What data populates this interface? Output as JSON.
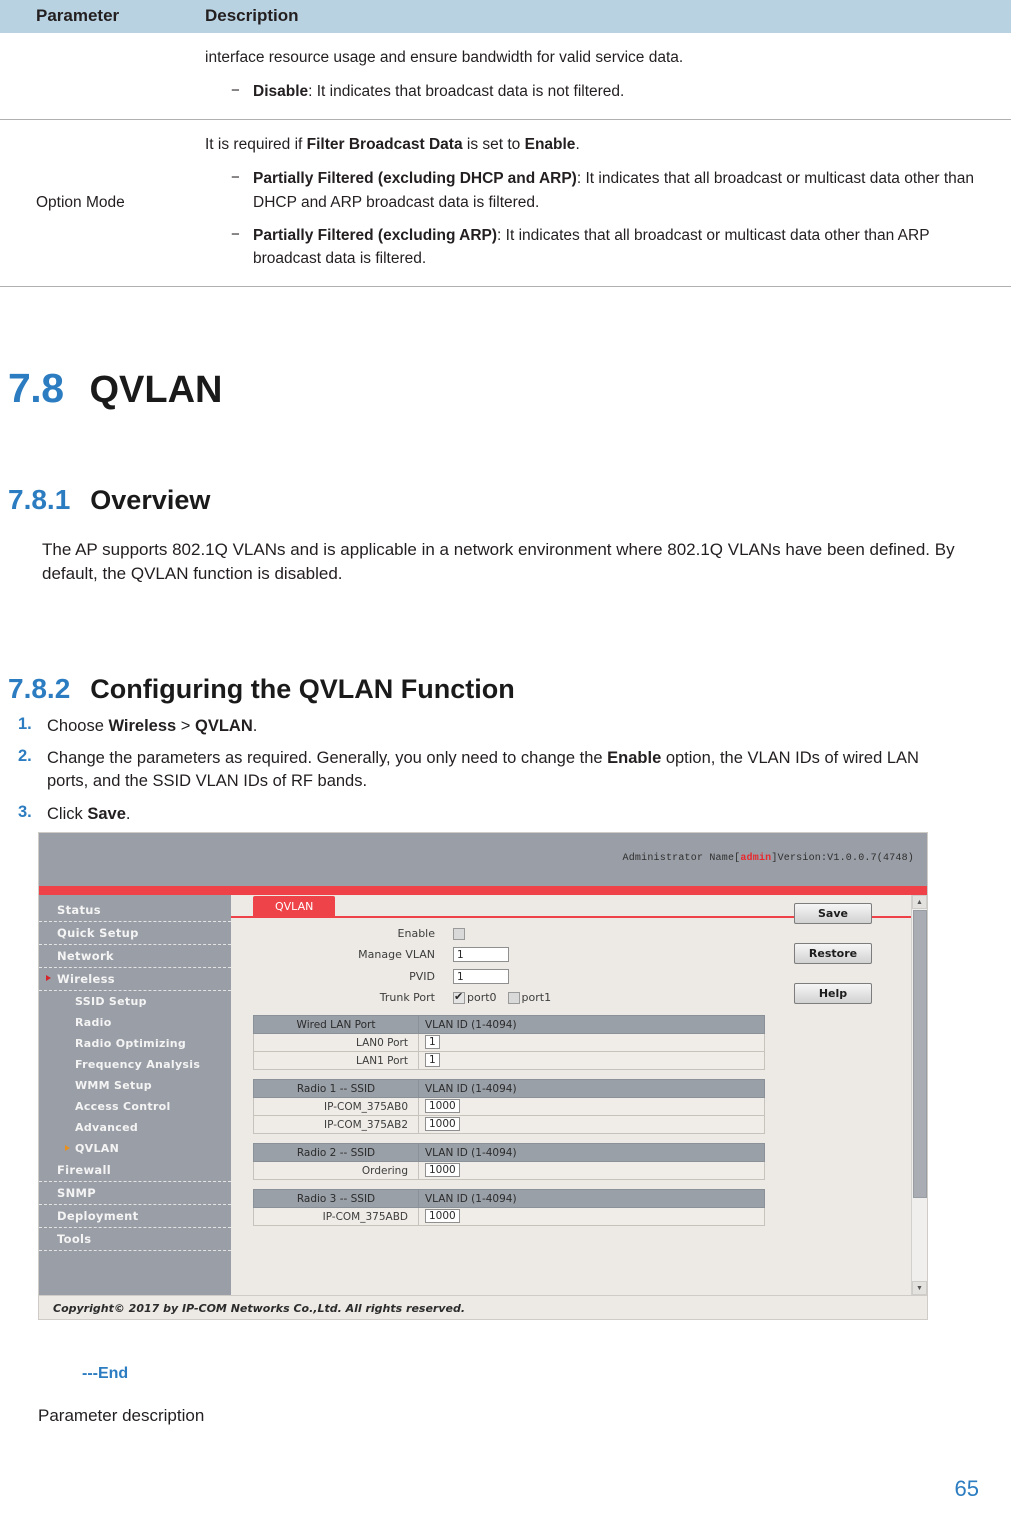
{
  "table": {
    "headers": [
      "Parameter",
      "Description"
    ],
    "rows": [
      {
        "parameter": "",
        "lead": "interface resource usage and ensure bandwidth for valid service data.",
        "bullets": [
          {
            "term": "Disable",
            "rest": ": It indicates that broadcast data is not filtered."
          }
        ]
      },
      {
        "parameter": "Option Mode",
        "lead_pre": "It is required if ",
        "lead_b1": "Filter Broadcast Data",
        "lead_mid": " is set to ",
        "lead_b2": "Enable",
        "lead_post": ".",
        "bullets": [
          {
            "term": "Partially Filtered (excluding DHCP and ARP)",
            "rest": ": It indicates that all broadcast or multicast data other than DHCP and ARP broadcast data is filtered."
          },
          {
            "term": "Partially Filtered (excluding ARP)",
            "rest": ": It indicates that all broadcast or multicast data other than ARP broadcast data is filtered."
          }
        ]
      }
    ],
    "dash_mark": "−"
  },
  "section_78": {
    "number": "7.8",
    "title": "QVLAN"
  },
  "section_781": {
    "number": "7.8.1",
    "title": "Overview",
    "paragraph": "The AP supports 802.1Q VLANs and is applicable in a network environment where 802.1Q VLANs have been defined. By default, the QVLAN function is disabled."
  },
  "section_782": {
    "number": "7.8.2",
    "title": "Configuring the QVLAN Function",
    "steps": [
      {
        "num": "1.",
        "pre": "Choose ",
        "b1": "Wireless",
        "mid": " > ",
        "b2": "QVLAN",
        "post": "."
      },
      {
        "num": "2.",
        "pre": "Change the parameters as required. Generally, you only need to change the ",
        "b1": "Enable",
        "mid": " option, the VLAN IDs of wired LAN ports, and the SSID VLAN IDs of RF bands.",
        "b2": "",
        "post": ""
      },
      {
        "num": "3.",
        "pre": "Click ",
        "b1": "Save",
        "mid": "",
        "b2": "",
        "post": "."
      }
    ]
  },
  "screenshot": {
    "admin_prefix": "Administrator Name[",
    "admin_user": "admin",
    "admin_suffix": "]Version:V1.0.0.7(4748)",
    "tab": "QVLAN",
    "nav": [
      {
        "label": "Status",
        "sub": false,
        "caret": false
      },
      {
        "label": "Quick Setup",
        "sub": false,
        "caret": false
      },
      {
        "label": "Network",
        "sub": false,
        "caret": false
      },
      {
        "label": "Wireless",
        "sub": false,
        "caret": true
      },
      {
        "label": "SSID Setup",
        "sub": true,
        "caret": false
      },
      {
        "label": "Radio",
        "sub": true,
        "caret": false
      },
      {
        "label": "Radio Optimizing",
        "sub": true,
        "caret": false
      },
      {
        "label": "Frequency Analysis",
        "sub": true,
        "caret": false
      },
      {
        "label": "WMM Setup",
        "sub": true,
        "caret": false
      },
      {
        "label": "Access Control",
        "sub": true,
        "caret": false
      },
      {
        "label": "Advanced",
        "sub": true,
        "caret": false
      },
      {
        "label": "QVLAN",
        "sub": true,
        "caret": true
      },
      {
        "label": "Firewall",
        "sub": false,
        "caret": false
      },
      {
        "label": "SNMP",
        "sub": false,
        "caret": false
      },
      {
        "label": "Deployment",
        "sub": false,
        "caret": false
      },
      {
        "label": "Tools",
        "sub": false,
        "caret": false
      }
    ],
    "form": {
      "enable_label": "Enable",
      "enable_checked": false,
      "manage_vlan_label": "Manage VLAN",
      "manage_vlan_value": "1",
      "pvid_label": "PVID",
      "pvid_value": "1",
      "trunk_label": "Trunk Port",
      "trunk_port0": "port0",
      "trunk_port0_checked": true,
      "trunk_port1": "port1",
      "trunk_port1_checked": false
    },
    "tables": [
      {
        "header_left": "Wired LAN Port",
        "header_right": "VLAN ID (1-4094)",
        "rows": [
          {
            "label": "LAN0 Port",
            "value": "1"
          },
          {
            "label": "LAN1 Port",
            "value": "1"
          }
        ]
      },
      {
        "header_left": "Radio 1 -- SSID",
        "header_right": "VLAN ID (1-4094)",
        "rows": [
          {
            "label": "IP-COM_375AB0",
            "value": "1000"
          },
          {
            "label": "IP-COM_375AB2",
            "value": "1000"
          }
        ]
      },
      {
        "header_left": "Radio 2 -- SSID",
        "header_right": "VLAN ID (1-4094)",
        "rows": [
          {
            "label": "Ordering",
            "value": "1000"
          }
        ]
      },
      {
        "header_left": "Radio 3 -- SSID",
        "header_right": "VLAN ID (1-4094)",
        "rows": [
          {
            "label": "IP-COM_375ABD",
            "value": "1000"
          }
        ]
      }
    ],
    "buttons": [
      "Save",
      "Restore",
      "Help"
    ],
    "scroll_up": "▲",
    "scroll_down": "▼",
    "footer": "Copyright© 2017 by IP-COM Networks Co.,Ltd. All rights reserved."
  },
  "end_marker": "---End",
  "parameter_description": "Parameter description",
  "page_number": "65",
  "colors": {
    "accent_blue": "#2b7cc0",
    "header_blue": "#b9d2e1",
    "ui_red": "#ee4349"
  }
}
